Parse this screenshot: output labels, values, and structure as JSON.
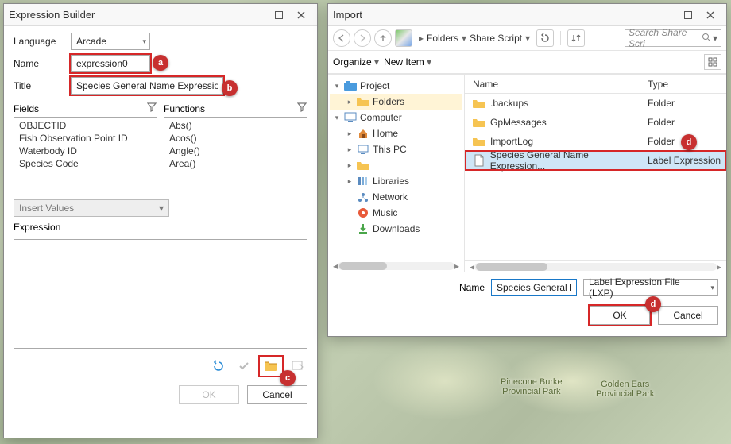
{
  "expression_builder": {
    "title": "Expression Builder",
    "language_label": "Language",
    "language_value": "Arcade",
    "name_label": "Name",
    "name_value": "expression0",
    "title_label": "Title",
    "title_value": "Species General Name Expression",
    "fields_label": "Fields",
    "functions_label": "Functions",
    "fields": [
      "OBJECTID",
      "Fish Observation Point ID",
      "Waterbody ID",
      "Species Code"
    ],
    "functions": [
      "Abs()",
      "Acos()",
      "Angle()",
      "Area()"
    ],
    "insert_values": "Insert Values",
    "expression_label": "Expression",
    "ok": "OK",
    "cancel": "Cancel"
  },
  "import": {
    "title": "Import",
    "crumb_folders": "Folders",
    "crumb_share": "Share Script",
    "search_placeholder": "Search Share Scri",
    "organize": "Organize",
    "new_item": "New Item",
    "tree": {
      "project": "Project",
      "folders": "Folders",
      "computer": "Computer",
      "home": "Home",
      "thispc": "This PC",
      "empty": "",
      "libraries": "Libraries",
      "network": "Network",
      "music": "Music",
      "downloads": "Downloads"
    },
    "col_name": "Name",
    "col_type": "Type",
    "files": [
      {
        "name": ".backups",
        "type": "Folder",
        "icon": "folder"
      },
      {
        "name": "GpMessages",
        "type": "Folder",
        "icon": "folder"
      },
      {
        "name": "ImportLog",
        "type": "Folder",
        "icon": "folder"
      },
      {
        "name": "Species General Name Expression...",
        "type": "Label Expression",
        "icon": "file",
        "selected": true
      }
    ],
    "name_label": "Name",
    "name_value": "Species General N",
    "filetype": "Label Expression File (LXP)",
    "ok": "OK",
    "cancel": "Cancel"
  },
  "map": {
    "label1a": "Pinecone Burke",
    "label1b": "Provincial Park",
    "label2a": "Golden Ears",
    "label2b": "Provincial Park"
  },
  "callouts": {
    "a": "a",
    "b": "b",
    "c": "c",
    "d1": "d",
    "d2": "d"
  }
}
